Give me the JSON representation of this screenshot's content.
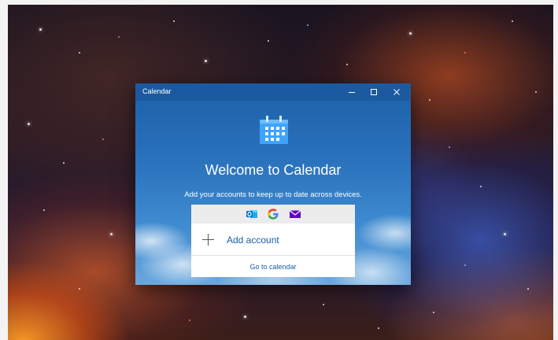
{
  "window": {
    "title": "Calendar",
    "controls": {
      "minimize_icon": "minimize-icon",
      "maximize_icon": "maximize-icon",
      "close_icon": "close-icon"
    }
  },
  "welcome": {
    "heading": "Welcome to Calendar",
    "subtitle": "Add your accounts to keep up to date across devices.",
    "icon": "calendar-icon"
  },
  "providers": [
    {
      "name": "outlook",
      "icon": "outlook-icon",
      "color": "#0072c6"
    },
    {
      "name": "google",
      "icon": "google-icon",
      "color": "#4285f4"
    },
    {
      "name": "yahoo",
      "icon": "yahoo-mail-icon",
      "color": "#5f01d1"
    }
  ],
  "actions": {
    "add_account_label": "Add account",
    "go_to_calendar_label": "Go to calendar"
  },
  "colors": {
    "accent": "#1a5ea8",
    "titlebar": "#1b5aa0"
  }
}
